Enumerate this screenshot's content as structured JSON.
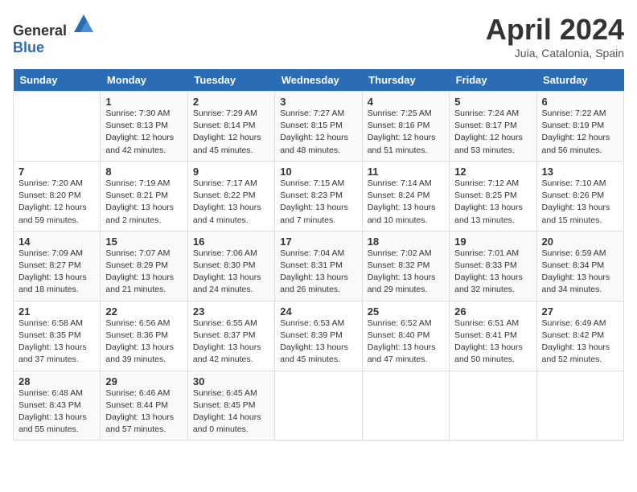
{
  "header": {
    "logo": {
      "text_general": "General",
      "text_blue": "Blue"
    },
    "title": "April 2024",
    "location": "Juia, Catalonia, Spain"
  },
  "days_of_week": [
    "Sunday",
    "Monday",
    "Tuesday",
    "Wednesday",
    "Thursday",
    "Friday",
    "Saturday"
  ],
  "weeks": [
    [
      {
        "day": "",
        "info": ""
      },
      {
        "day": "1",
        "info": "Sunrise: 7:30 AM\nSunset: 8:13 PM\nDaylight: 12 hours\nand 42 minutes."
      },
      {
        "day": "2",
        "info": "Sunrise: 7:29 AM\nSunset: 8:14 PM\nDaylight: 12 hours\nand 45 minutes."
      },
      {
        "day": "3",
        "info": "Sunrise: 7:27 AM\nSunset: 8:15 PM\nDaylight: 12 hours\nand 48 minutes."
      },
      {
        "day": "4",
        "info": "Sunrise: 7:25 AM\nSunset: 8:16 PM\nDaylight: 12 hours\nand 51 minutes."
      },
      {
        "day": "5",
        "info": "Sunrise: 7:24 AM\nSunset: 8:17 PM\nDaylight: 12 hours\nand 53 minutes."
      },
      {
        "day": "6",
        "info": "Sunrise: 7:22 AM\nSunset: 8:19 PM\nDaylight: 12 hours\nand 56 minutes."
      }
    ],
    [
      {
        "day": "7",
        "info": "Sunrise: 7:20 AM\nSunset: 8:20 PM\nDaylight: 12 hours\nand 59 minutes."
      },
      {
        "day": "8",
        "info": "Sunrise: 7:19 AM\nSunset: 8:21 PM\nDaylight: 13 hours\nand 2 minutes."
      },
      {
        "day": "9",
        "info": "Sunrise: 7:17 AM\nSunset: 8:22 PM\nDaylight: 13 hours\nand 4 minutes."
      },
      {
        "day": "10",
        "info": "Sunrise: 7:15 AM\nSunset: 8:23 PM\nDaylight: 13 hours\nand 7 minutes."
      },
      {
        "day": "11",
        "info": "Sunrise: 7:14 AM\nSunset: 8:24 PM\nDaylight: 13 hours\nand 10 minutes."
      },
      {
        "day": "12",
        "info": "Sunrise: 7:12 AM\nSunset: 8:25 PM\nDaylight: 13 hours\nand 13 minutes."
      },
      {
        "day": "13",
        "info": "Sunrise: 7:10 AM\nSunset: 8:26 PM\nDaylight: 13 hours\nand 15 minutes."
      }
    ],
    [
      {
        "day": "14",
        "info": "Sunrise: 7:09 AM\nSunset: 8:27 PM\nDaylight: 13 hours\nand 18 minutes."
      },
      {
        "day": "15",
        "info": "Sunrise: 7:07 AM\nSunset: 8:29 PM\nDaylight: 13 hours\nand 21 minutes."
      },
      {
        "day": "16",
        "info": "Sunrise: 7:06 AM\nSunset: 8:30 PM\nDaylight: 13 hours\nand 24 minutes."
      },
      {
        "day": "17",
        "info": "Sunrise: 7:04 AM\nSunset: 8:31 PM\nDaylight: 13 hours\nand 26 minutes."
      },
      {
        "day": "18",
        "info": "Sunrise: 7:02 AM\nSunset: 8:32 PM\nDaylight: 13 hours\nand 29 minutes."
      },
      {
        "day": "19",
        "info": "Sunrise: 7:01 AM\nSunset: 8:33 PM\nDaylight: 13 hours\nand 32 minutes."
      },
      {
        "day": "20",
        "info": "Sunrise: 6:59 AM\nSunset: 8:34 PM\nDaylight: 13 hours\nand 34 minutes."
      }
    ],
    [
      {
        "day": "21",
        "info": "Sunrise: 6:58 AM\nSunset: 8:35 PM\nDaylight: 13 hours\nand 37 minutes."
      },
      {
        "day": "22",
        "info": "Sunrise: 6:56 AM\nSunset: 8:36 PM\nDaylight: 13 hours\nand 39 minutes."
      },
      {
        "day": "23",
        "info": "Sunrise: 6:55 AM\nSunset: 8:37 PM\nDaylight: 13 hours\nand 42 minutes."
      },
      {
        "day": "24",
        "info": "Sunrise: 6:53 AM\nSunset: 8:39 PM\nDaylight: 13 hours\nand 45 minutes."
      },
      {
        "day": "25",
        "info": "Sunrise: 6:52 AM\nSunset: 8:40 PM\nDaylight: 13 hours\nand 47 minutes."
      },
      {
        "day": "26",
        "info": "Sunrise: 6:51 AM\nSunset: 8:41 PM\nDaylight: 13 hours\nand 50 minutes."
      },
      {
        "day": "27",
        "info": "Sunrise: 6:49 AM\nSunset: 8:42 PM\nDaylight: 13 hours\nand 52 minutes."
      }
    ],
    [
      {
        "day": "28",
        "info": "Sunrise: 6:48 AM\nSunset: 8:43 PM\nDaylight: 13 hours\nand 55 minutes."
      },
      {
        "day": "29",
        "info": "Sunrise: 6:46 AM\nSunset: 8:44 PM\nDaylight: 13 hours\nand 57 minutes."
      },
      {
        "day": "30",
        "info": "Sunrise: 6:45 AM\nSunset: 8:45 PM\nDaylight: 14 hours\nand 0 minutes."
      },
      {
        "day": "",
        "info": ""
      },
      {
        "day": "",
        "info": ""
      },
      {
        "day": "",
        "info": ""
      },
      {
        "day": "",
        "info": ""
      }
    ]
  ]
}
